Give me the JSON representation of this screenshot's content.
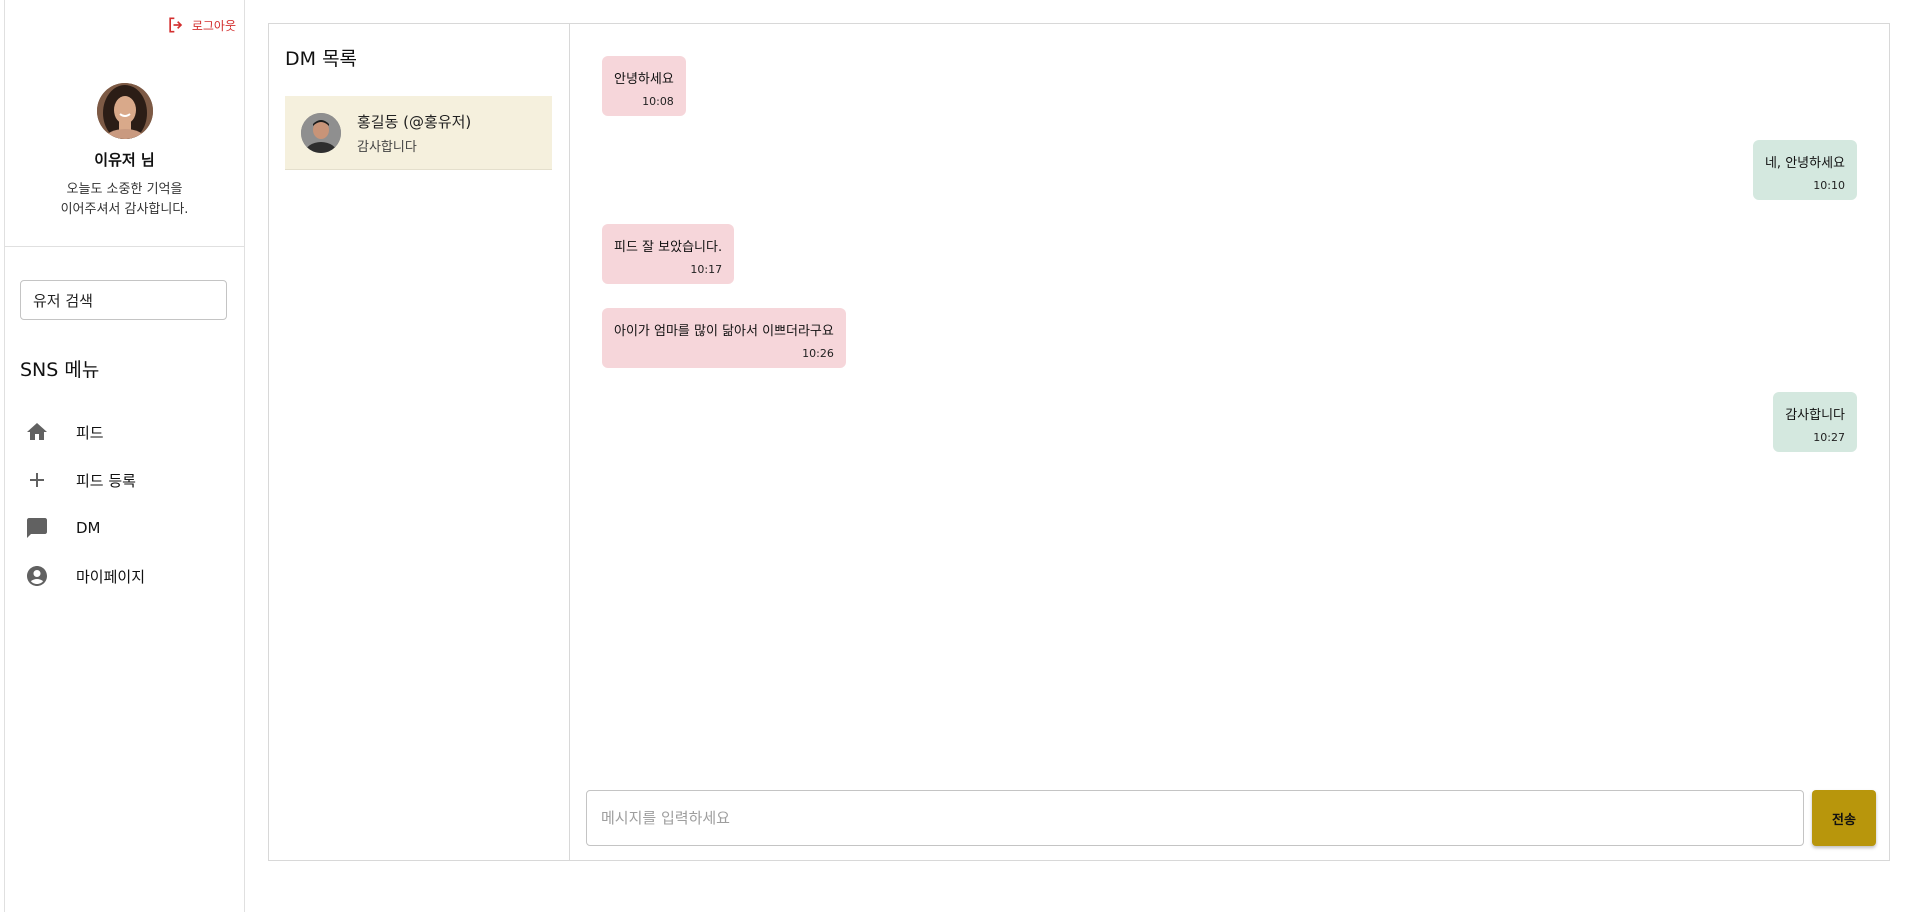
{
  "sidebar": {
    "logout_label": "로그아웃",
    "profile": {
      "name": "이유저 님",
      "message": "오늘도 소중한 기억을\n이어주셔서 감사합니다."
    },
    "search": {
      "placeholder": "유저 검색",
      "value": "유저 검색"
    },
    "menu_title": "SNS 메뉴",
    "menu": [
      {
        "label": "피드",
        "icon": "home-icon"
      },
      {
        "label": "피드 등록",
        "icon": "plus-icon"
      },
      {
        "label": "DM",
        "icon": "chat-icon"
      },
      {
        "label": "마이페이지",
        "icon": "account-circle-icon"
      }
    ]
  },
  "dm_list": {
    "title": "DM 목록",
    "items": [
      {
        "name": "홍길동 (@홍유저)",
        "last_message": "감사합니다"
      }
    ]
  },
  "chat": {
    "messages": [
      {
        "direction": "received",
        "text": "안녕하세요",
        "time": "10:08"
      },
      {
        "direction": "sent",
        "text": "네, 안녕하세요",
        "time": "10:10"
      },
      {
        "direction": "received",
        "text": "피드 잘 보았습니다.",
        "time": "10:17"
      },
      {
        "direction": "received",
        "text": "아이가 엄마를 많이 닮아서 이쁘더라구요",
        "time": "10:26"
      },
      {
        "direction": "sent",
        "text": "감사합니다",
        "time": "10:27"
      }
    ],
    "input_placeholder": "메시지를 입력하세요",
    "send_label": "전송"
  },
  "colors": {
    "logout": "#d32f2f",
    "selected_dm_bg": "#f5f0dd",
    "received_bubble": "#f6d6da",
    "sent_bubble": "#d4e8df",
    "send_button": "#b8960c"
  }
}
